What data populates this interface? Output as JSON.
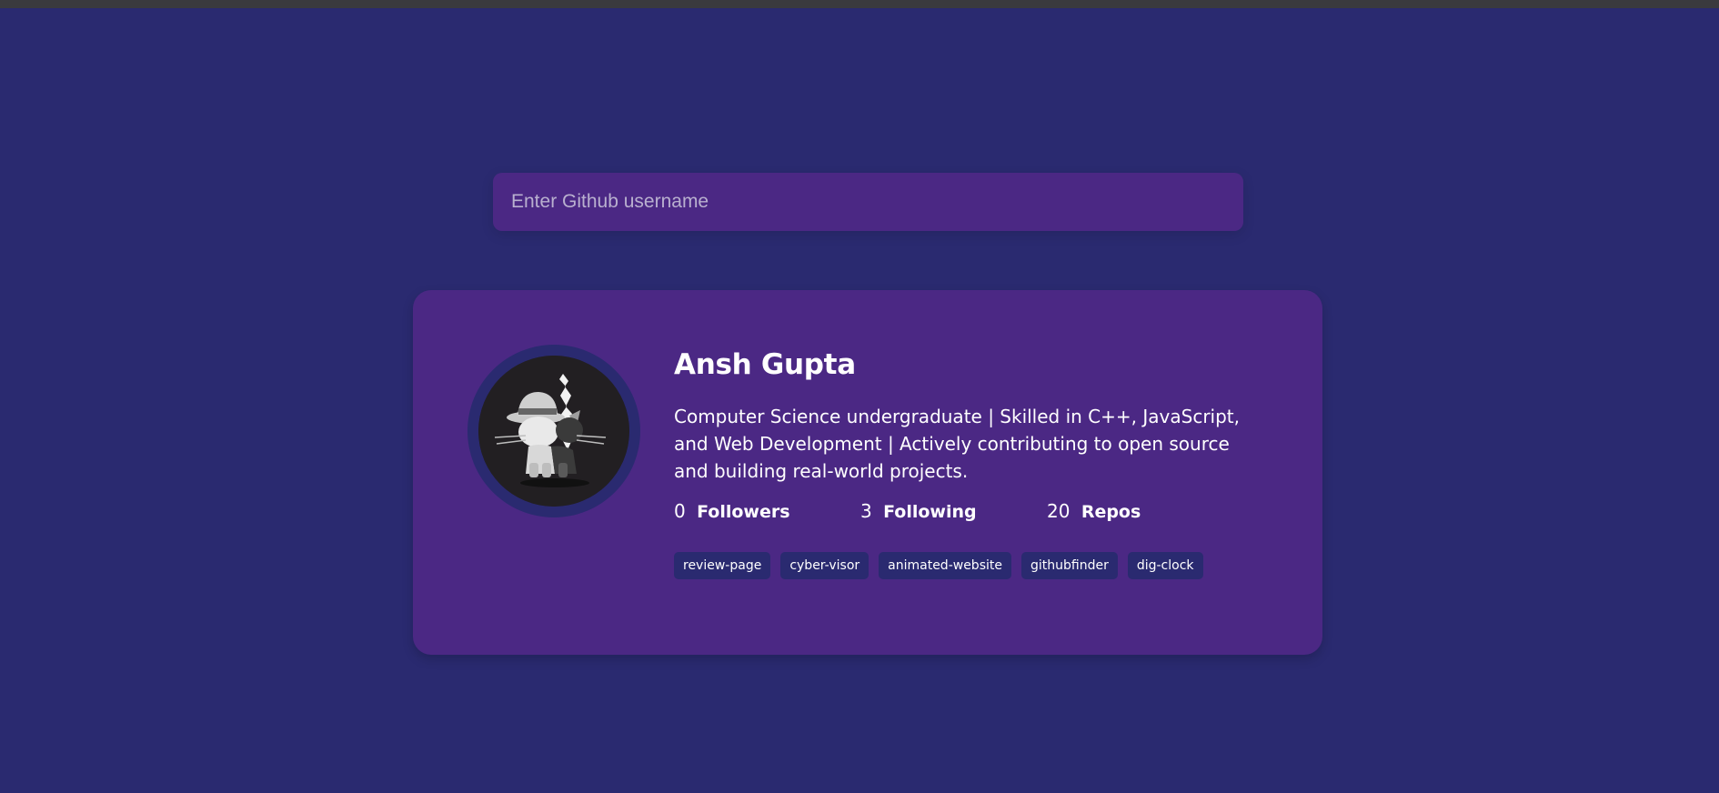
{
  "search": {
    "placeholder": "Enter Github username"
  },
  "user": {
    "name": "Ansh Gupta",
    "bio": "Computer Science undergraduate | Skilled in C++, JavaScript, and Web Development | Actively contributing to open source and building real-world projects.",
    "avatar_icon": "cat-avatar-icon"
  },
  "stats": [
    {
      "value": "0",
      "label": "Followers"
    },
    {
      "value": "3",
      "label": "Following"
    },
    {
      "value": "20",
      "label": "Repos"
    }
  ],
  "repos": [
    "review-page",
    "cyber-visor",
    "animated-website",
    "githubfinder",
    "dig-clock"
  ],
  "colors": {
    "background": "#2a2a70",
    "card": "#4b2884",
    "repo_tag": "#2a2a70",
    "topbar": "#3a3a3e",
    "text": "#ffffff"
  }
}
